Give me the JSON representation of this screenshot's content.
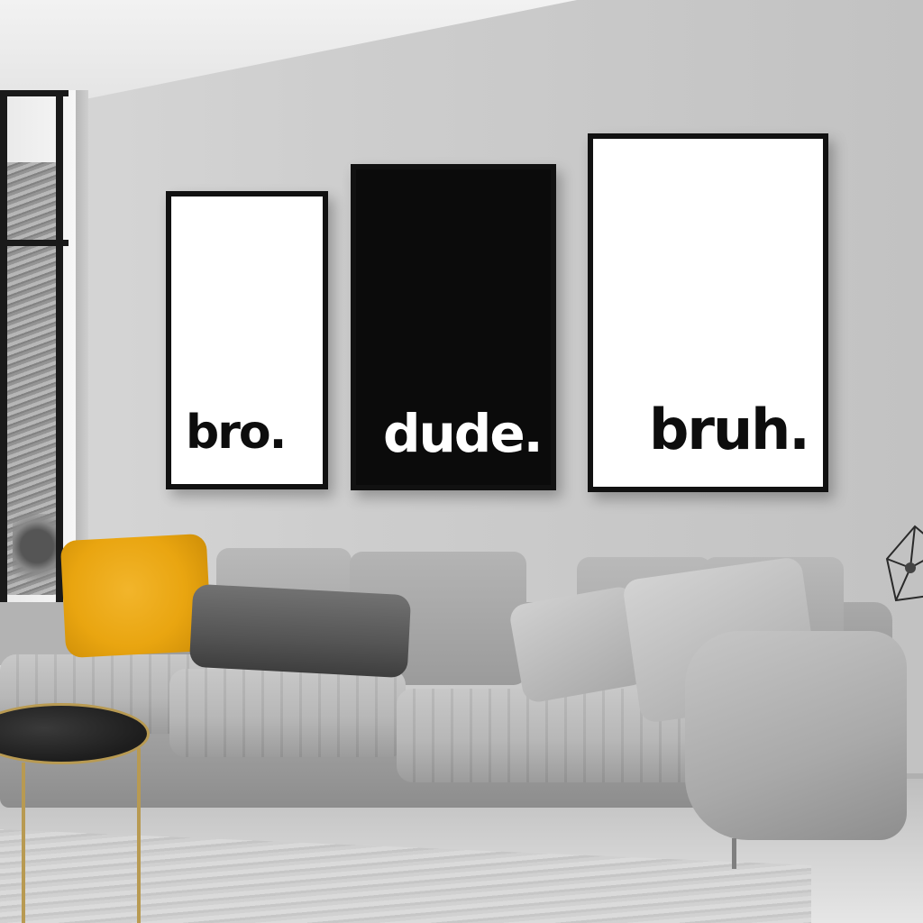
{
  "posters": [
    {
      "text": "bro.",
      "background": "#ffffff",
      "ink": "#0d0d0d"
    },
    {
      "text": "dude.",
      "background": "#0b0b0b",
      "ink": "#ffffff"
    },
    {
      "text": "bruh.",
      "background": "#ffffff",
      "ink": "#0d0d0d"
    }
  ],
  "colors": {
    "wall": "#cdcdcd",
    "frame": "#111111",
    "sofa": "#b7b7b7",
    "accent_pillow": "#e9a510",
    "dark_pillow": "#555555",
    "table_rim": "#b89a52"
  }
}
